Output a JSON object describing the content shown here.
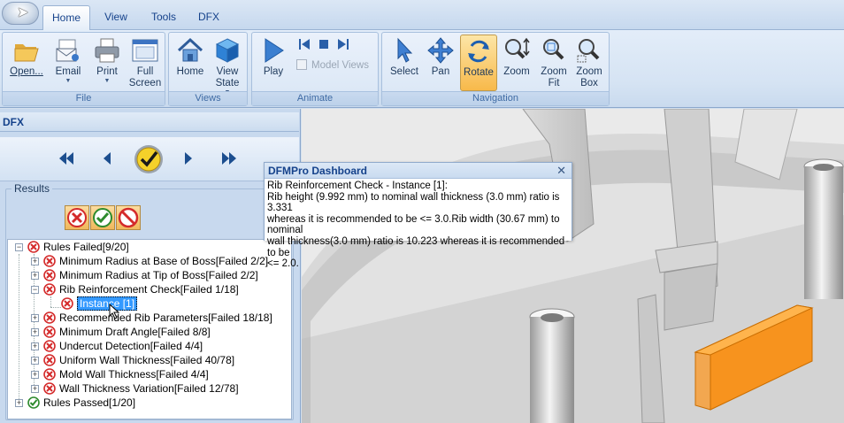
{
  "tabs": [
    {
      "label": "Home",
      "active": true
    },
    {
      "label": "View",
      "active": false
    },
    {
      "label": "Tools",
      "active": false
    },
    {
      "label": "DFX",
      "active": false
    }
  ],
  "ribbon": {
    "file": {
      "label": "File",
      "open": "Open...",
      "email": "Email",
      "print": "Print",
      "full_screen_1": "Full",
      "full_screen_2": "Screen"
    },
    "views": {
      "label": "Views",
      "home": "Home",
      "view_state_1": "View",
      "view_state_2": "State"
    },
    "animate": {
      "label": "Animate",
      "play": "Play",
      "model_views": "Model Views"
    },
    "navigation": {
      "label": "Navigation",
      "select": "Select",
      "pan": "Pan",
      "rotate": "Rotate",
      "zoom": "Zoom",
      "zoom_fit_1": "Zoom",
      "zoom_fit_2": "Fit",
      "zoom_box_1": "Zoom",
      "zoom_box_2": "Box"
    }
  },
  "panel": {
    "title": "DFX",
    "results_label": "Results"
  },
  "tree": {
    "rules_failed": "Rules Failed[9/20]",
    "items": [
      {
        "label": "Minimum Radius at Base of Boss[Failed 2/2]"
      },
      {
        "label": "Minimum Radius at Tip of Boss[Failed 2/2]"
      },
      {
        "label": "Rib Reinforcement Check[Failed 1/18]"
      },
      {
        "label": "Instance [1]"
      },
      {
        "label": "Recommended Rib Parameters[Failed 18/18]"
      },
      {
        "label": "Minimum Draft Angle[Failed 8/8]"
      },
      {
        "label": "Undercut Detection[Failed 4/4]"
      },
      {
        "label": "Uniform Wall Thickness[Failed 40/78]"
      },
      {
        "label": "Mold Wall Thickness[Failed 4/4]"
      },
      {
        "label": "Wall Thickness Variation[Failed 12/78]"
      }
    ],
    "rules_passed": "Rules Passed[1/20]"
  },
  "dashboard": {
    "title": "DFMPro Dashboard",
    "close": "✕",
    "lines": [
      "Rib Reinforcement Check - Instance [1]:",
      "Rib height (9.992 mm) to nominal wall thickness (3.0 mm) ratio is 3.331",
      "whereas it is recommended to be <= 3.0.Rib width (30.67 mm) to nominal",
      "wall thickness(3.0 mm) ratio is 10.223 whereas it is recommended to be",
      "<= 2.0."
    ]
  },
  "colors": {
    "highlight": "#f7931e",
    "fail": "#d42a2a",
    "pass": "#2e8b2e",
    "ribbon_pressed": "#f8b94a"
  }
}
